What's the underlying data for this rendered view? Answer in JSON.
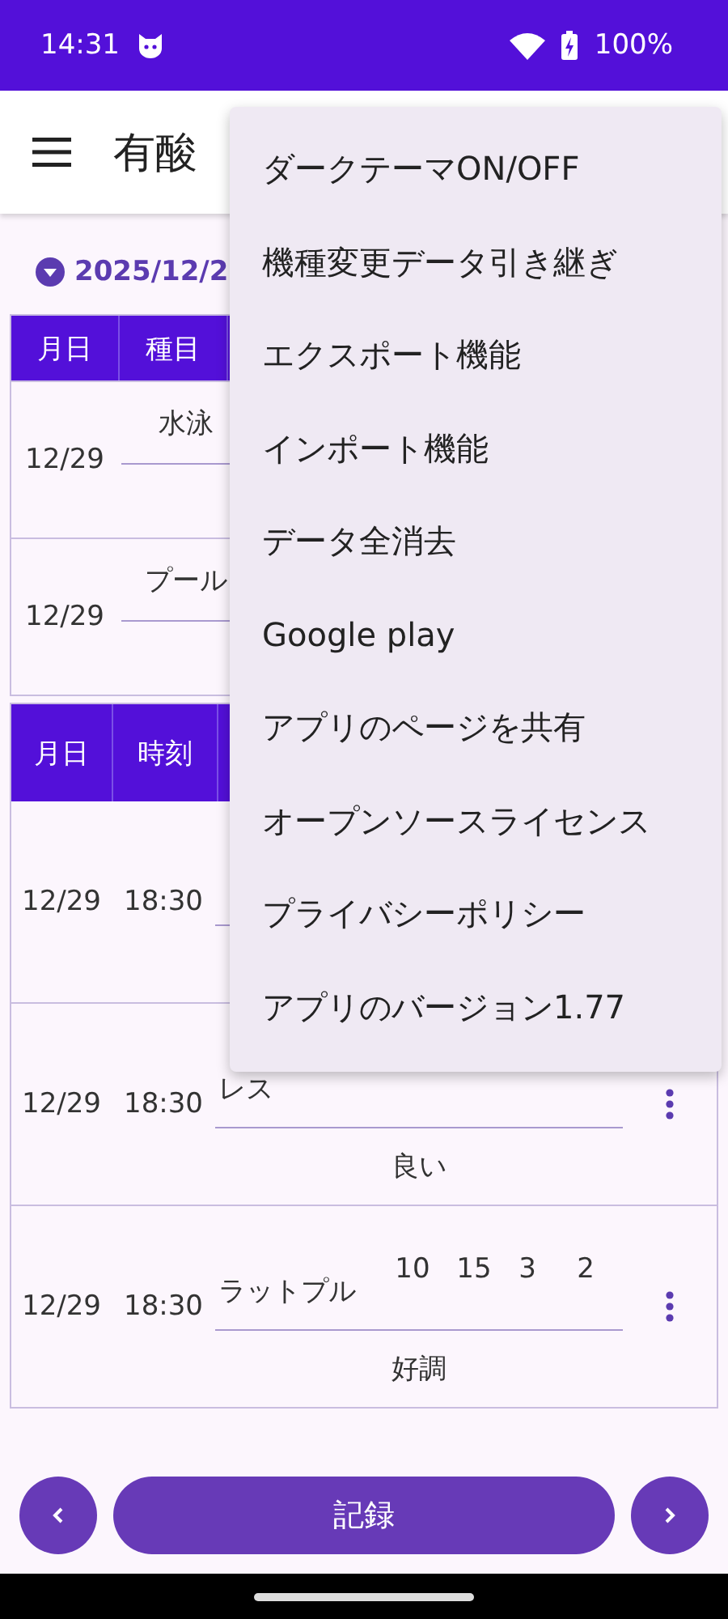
{
  "status_bar": {
    "time": "14:31",
    "battery": "100%"
  },
  "app_bar": {
    "title": "有酸"
  },
  "date_selector": {
    "date": "2025/12/2"
  },
  "cardio_table": {
    "columns": [
      "月日",
      "種目"
    ],
    "rows": [
      {
        "date": "12/29",
        "exercise": "水泳"
      },
      {
        "date": "12/29",
        "exercise": "プール"
      }
    ]
  },
  "strength_table": {
    "columns": [
      "月日",
      "時刻"
    ],
    "rows": [
      {
        "date": "12/29",
        "time": "18:30"
      },
      {
        "date": "12/29",
        "time": "18:30",
        "exercise": "レス",
        "note": "良い"
      },
      {
        "date": "12/29",
        "time": "18:30",
        "exercise": "ラットプル",
        "values": [
          "10",
          "15",
          "3",
          "2"
        ],
        "note": "好調"
      }
    ]
  },
  "menu": {
    "items": [
      "ダークテーマON/OFF",
      "機種変更データ引き継ぎ",
      "エクスポート機能",
      "インポート機能",
      "データ全消去",
      "Google play",
      "アプリのページを共有",
      "オープンソースライセンス",
      "プライバシーポリシー",
      "アプリのバージョン1.77"
    ]
  },
  "bottom_bar": {
    "record_button": "記録"
  }
}
